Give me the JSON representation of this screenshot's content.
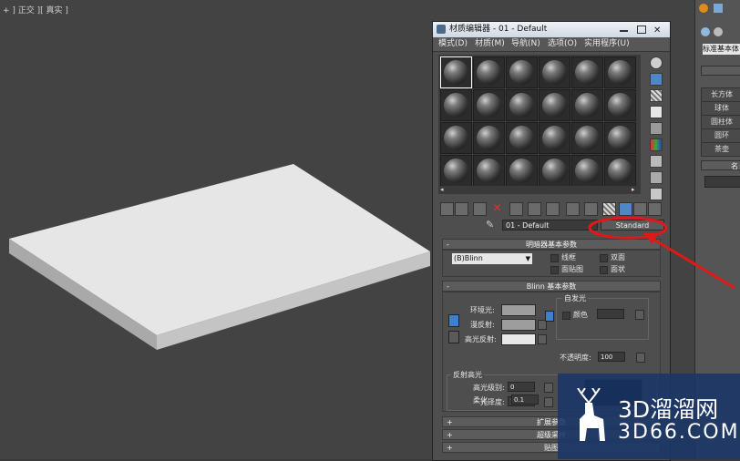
{
  "viewport": {
    "label": "+ ] 正交 ][ 真实 ]"
  },
  "material_editor": {
    "title": "材质编辑器 - 01 - Default",
    "menus": [
      "模式(D)",
      "材质(M)",
      "导航(N)",
      "选项(O)",
      "实用程序(U)"
    ],
    "material_name": "01 - Default",
    "material_type": "Standard",
    "shader_rollout": {
      "title": "明暗器基本参数",
      "shader": "(B)Blinn",
      "options": [
        "线框",
        "双面",
        "面贴图",
        "面状"
      ]
    },
    "blinn_rollout": {
      "title": "Blinn 基本参数",
      "self_illum_label": "自发光",
      "color_label": "颜色",
      "ambient_label": "环境光:",
      "diffuse_label": "漫反射:",
      "specular_label": "高光反射:",
      "opacity_label": "不透明度:",
      "opacity_value": "100",
      "spec_group_label": "反射高光",
      "spec_level_label": "高光级别:",
      "spec_level_value": "0",
      "glossiness_label": "光泽度:",
      "glossiness_value": "10",
      "soften_label": "柔化:",
      "soften_value": "0.1"
    },
    "lower_rollouts": [
      "扩展参数",
      "超级采样",
      "贴图"
    ]
  },
  "right_panel": {
    "dropdown": "标准基本体",
    "buttons": [
      "长方体",
      "球体",
      "圆柱体",
      "圆环",
      "茶壶"
    ],
    "name_rollout": "名"
  },
  "watermark": {
    "brand": "3D溜溜网",
    "domain": "3D66.COM"
  },
  "colors": {
    "annotation": "#e01818",
    "title_bar": "#dfe6ee",
    "viewport_bg": "#434343"
  }
}
